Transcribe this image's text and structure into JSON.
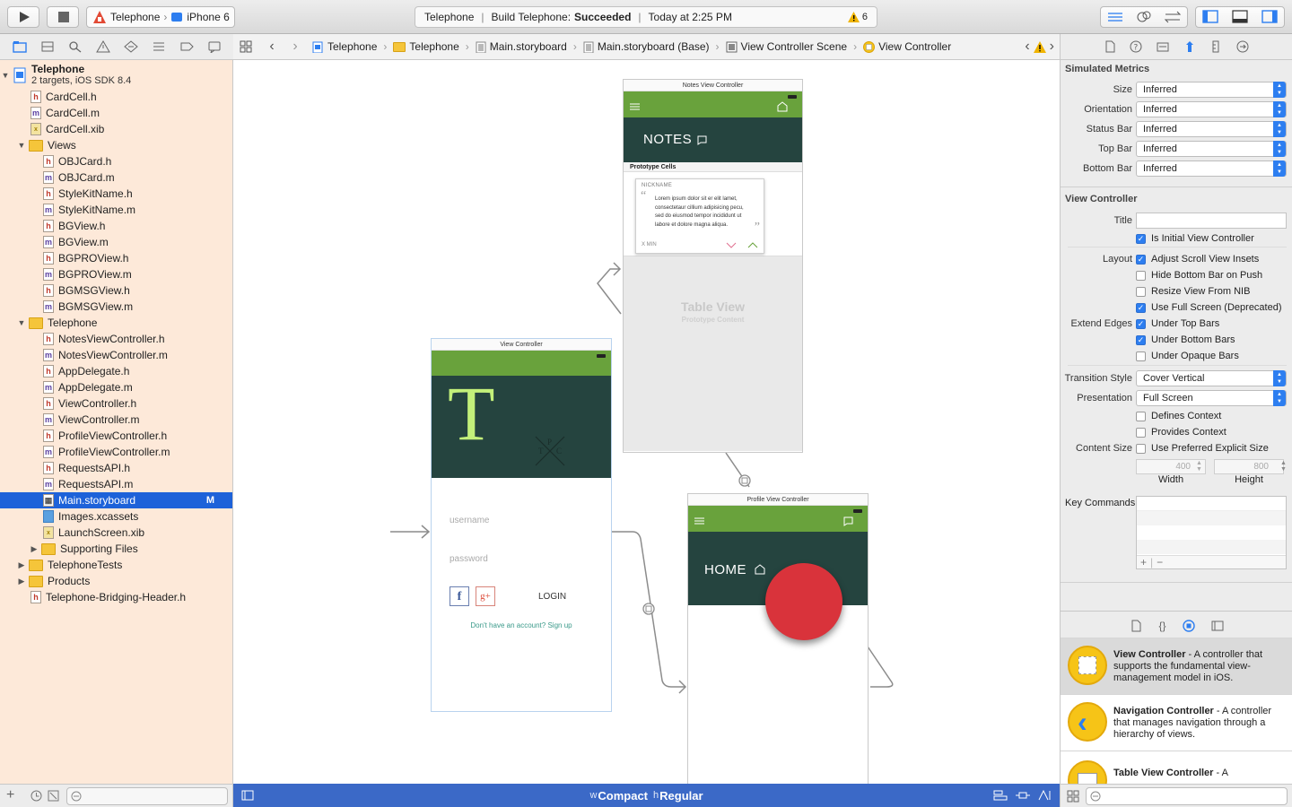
{
  "toolbar": {
    "scheme_target": "Telephone",
    "scheme_device": "iPhone 6",
    "activity_project": "Telephone",
    "activity_build_prefix": "Build Telephone:",
    "activity_build_status": "Succeeded",
    "activity_time": "Today at 2:25 PM",
    "warning_count": "6"
  },
  "jumpbar": {
    "crumbs": [
      "Telephone",
      "Telephone",
      "Main.storyboard",
      "Main.storyboard (Base)",
      "View Controller Scene",
      "View Controller"
    ]
  },
  "navigator": {
    "project_name": "Telephone",
    "project_sub": "2 targets, iOS SDK 8.4",
    "items": [
      {
        "label": "CardCell.h"
      },
      {
        "label": "CardCell.m"
      },
      {
        "label": "CardCell.xib"
      },
      {
        "label": "Views"
      },
      {
        "label": "OBJCard.h"
      },
      {
        "label": "OBJCard.m"
      },
      {
        "label": "StyleKitName.h"
      },
      {
        "label": "StyleKitName.m"
      },
      {
        "label": "BGView.h"
      },
      {
        "label": "BGView.m"
      },
      {
        "label": "BGPROView.h"
      },
      {
        "label": "BGPROView.m"
      },
      {
        "label": "BGMSGView.h"
      },
      {
        "label": "BGMSGView.m"
      },
      {
        "label": "Telephone"
      },
      {
        "label": "NotesViewController.h"
      },
      {
        "label": "NotesViewController.m"
      },
      {
        "label": "AppDelegate.h"
      },
      {
        "label": "AppDelegate.m"
      },
      {
        "label": "ViewController.h"
      },
      {
        "label": "ViewController.m"
      },
      {
        "label": "ProfileViewController.h"
      },
      {
        "label": "ProfileViewController.m"
      },
      {
        "label": "RequestsAPI.h"
      },
      {
        "label": "RequestsAPI.m"
      },
      {
        "label": "Main.storyboard",
        "badge": "M"
      },
      {
        "label": "Images.xcassets"
      },
      {
        "label": "LaunchScreen.xib"
      },
      {
        "label": "Supporting Files"
      },
      {
        "label": "TelephoneTests"
      },
      {
        "label": "Products"
      },
      {
        "label": "Telephone-Bridging-Header.h"
      }
    ]
  },
  "canvas": {
    "notes_scene": {
      "title": "Notes View Controller",
      "header": "NOTES",
      "section": "Prototype Cells",
      "cell_nickname": "NICKNAME",
      "cell_body": "Lorem ipsum dolor sit er elit lamet, consectetaur cillium adipisicing pecu, sed do eiusmod tempor incididunt ut labore et dolore magna aliqua.",
      "cell_meta": "X MIN",
      "table_title": "Table View",
      "table_sub": "Prototype Content"
    },
    "login_scene": {
      "title": "View Controller",
      "logo_letter": "T",
      "username_placeholder": "username",
      "password_placeholder": "password",
      "login_label": "LOGIN",
      "signup_text": "Don't have an account?",
      "signup_link": "Sign up"
    },
    "profile_scene": {
      "title": "Profile View Controller",
      "header": "HOME"
    }
  },
  "bottombar": {
    "w_prefix": "w",
    "w_value": "Compact",
    "h_prefix": "h",
    "h_value": "Regular"
  },
  "inspector": {
    "simulated_metrics": "Simulated Metrics",
    "metrics": [
      {
        "label": "Size",
        "value": "Inferred"
      },
      {
        "label": "Orientation",
        "value": "Inferred"
      },
      {
        "label": "Status Bar",
        "value": "Inferred"
      },
      {
        "label": "Top Bar",
        "value": "Inferred"
      },
      {
        "label": "Bottom Bar",
        "value": "Inferred"
      }
    ],
    "view_controller_header": "View Controller",
    "title_label": "Title",
    "title_value": "",
    "initial_vc": "Is Initial View Controller",
    "layout_label": "Layout",
    "layout_options": [
      "Adjust Scroll View Insets",
      "Hide Bottom Bar on Push",
      "Resize View From NIB",
      "Use Full Screen (Deprecated)"
    ],
    "extend_label": "Extend Edges",
    "extend_options": [
      "Under Top Bars",
      "Under Bottom Bars",
      "Under Opaque Bars"
    ],
    "transition_label": "Transition Style",
    "transition_value": "Cover Vertical",
    "presentation_label": "Presentation",
    "presentation_value": "Full Screen",
    "defines_context": "Defines Context",
    "provides_context": "Provides Context",
    "content_size_label": "Content Size",
    "preferred_size": "Use Preferred Explicit Size",
    "width_value": "400",
    "height_value": "800",
    "width_label": "Width",
    "height_label": "Height",
    "key_commands_label": "Key Commands",
    "library": [
      {
        "title": "View Controller",
        "desc": " - A controller that supports the fundamental view-management model in iOS."
      },
      {
        "title": "Navigation Controller",
        "desc": " - A controller that manages navigation through a hierarchy of views."
      },
      {
        "title": "Table View Controller",
        "desc": " - A"
      }
    ]
  },
  "colors": {
    "accent_blue": "#2d7ef0",
    "selection_blue": "#1d62d9",
    "app_green": "#69a23c",
    "app_dark_teal": "#25443f",
    "logo_lime": "#c3f07a",
    "profile_red": "#d9333b",
    "navigator_bg": "#fde9d9",
    "bottom_bar_blue": "#3b69c7"
  }
}
